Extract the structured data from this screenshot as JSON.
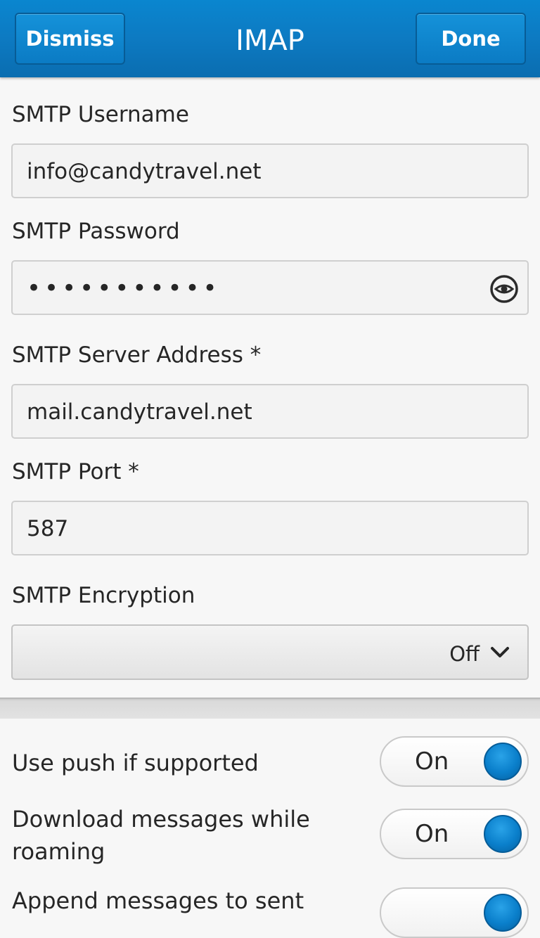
{
  "header": {
    "dismiss_label": "Dismiss",
    "title": "IMAP",
    "done_label": "Done"
  },
  "form": {
    "smtp_username": {
      "label": "SMTP Username",
      "value": "info@candytravel.net"
    },
    "smtp_password": {
      "label": "SMTP Password",
      "value": "•••••••••••"
    },
    "smtp_server": {
      "label": "SMTP Server Address *",
      "value": "mail.candytravel.net"
    },
    "smtp_port": {
      "label": "SMTP Port *",
      "value": "587"
    },
    "smtp_encryption": {
      "label": "SMTP Encryption",
      "value": "Off"
    }
  },
  "toggles": [
    {
      "label": "Use push if supported",
      "state": "On"
    },
    {
      "label": "Download messages while roaming",
      "state": "On"
    },
    {
      "label": "Append messages to sent"
    }
  ],
  "colors": {
    "header_blue": "#0a7fc8",
    "knob_blue": "#0a7fcb"
  },
  "icons": {
    "password_reveal": "eye-icon",
    "dropdown": "chevron-down-icon"
  }
}
